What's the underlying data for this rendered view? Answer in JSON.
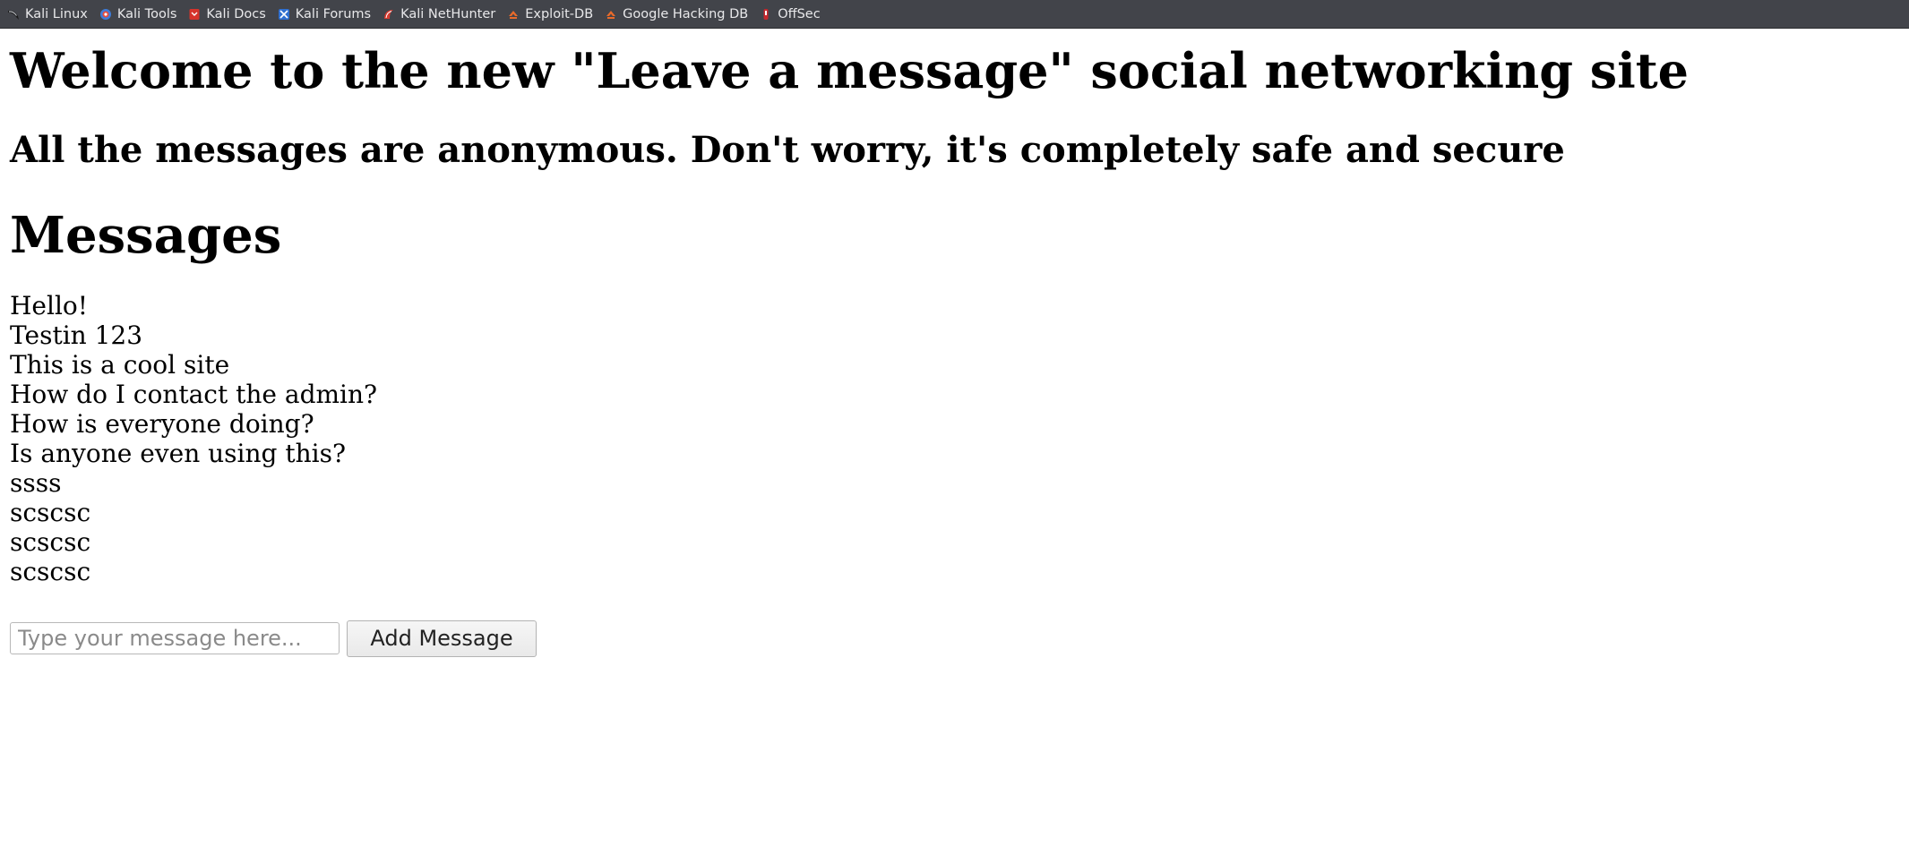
{
  "bookmarks": [
    {
      "label": "Kali Linux",
      "icon": "kali-dragon-icon"
    },
    {
      "label": "Kali Tools",
      "icon": "kali-tools-icon"
    },
    {
      "label": "Kali Docs",
      "icon": "kali-docs-icon"
    },
    {
      "label": "Kali Forums",
      "icon": "kali-forums-icon"
    },
    {
      "label": "Kali NetHunter",
      "icon": "kali-nethunter-icon"
    },
    {
      "label": "Exploit-DB",
      "icon": "exploit-db-icon"
    },
    {
      "label": "Google Hacking DB",
      "icon": "google-hacking-db-icon"
    },
    {
      "label": "OffSec",
      "icon": "offsec-icon"
    }
  ],
  "page": {
    "heading": "Welcome to the new \"Leave a message\" social networking site",
    "subheading": "All the messages are anonymous. Don't worry, it's completely safe and secure",
    "messages_title": "Messages",
    "messages": [
      "Hello!",
      "Testin 123",
      "This is a cool site",
      "How do I contact the admin?",
      "How is everyone doing?",
      "Is anyone even using this?",
      "ssss",
      "scscsc",
      "scscsc",
      "scscsc"
    ],
    "form": {
      "input_value": "",
      "input_placeholder": "Type your message here...",
      "button_label": "Add Message"
    }
  },
  "colors": {
    "toolbar_bg": "#42444a",
    "toolbar_text": "#e8e8ea",
    "page_bg": "#ffffff"
  }
}
